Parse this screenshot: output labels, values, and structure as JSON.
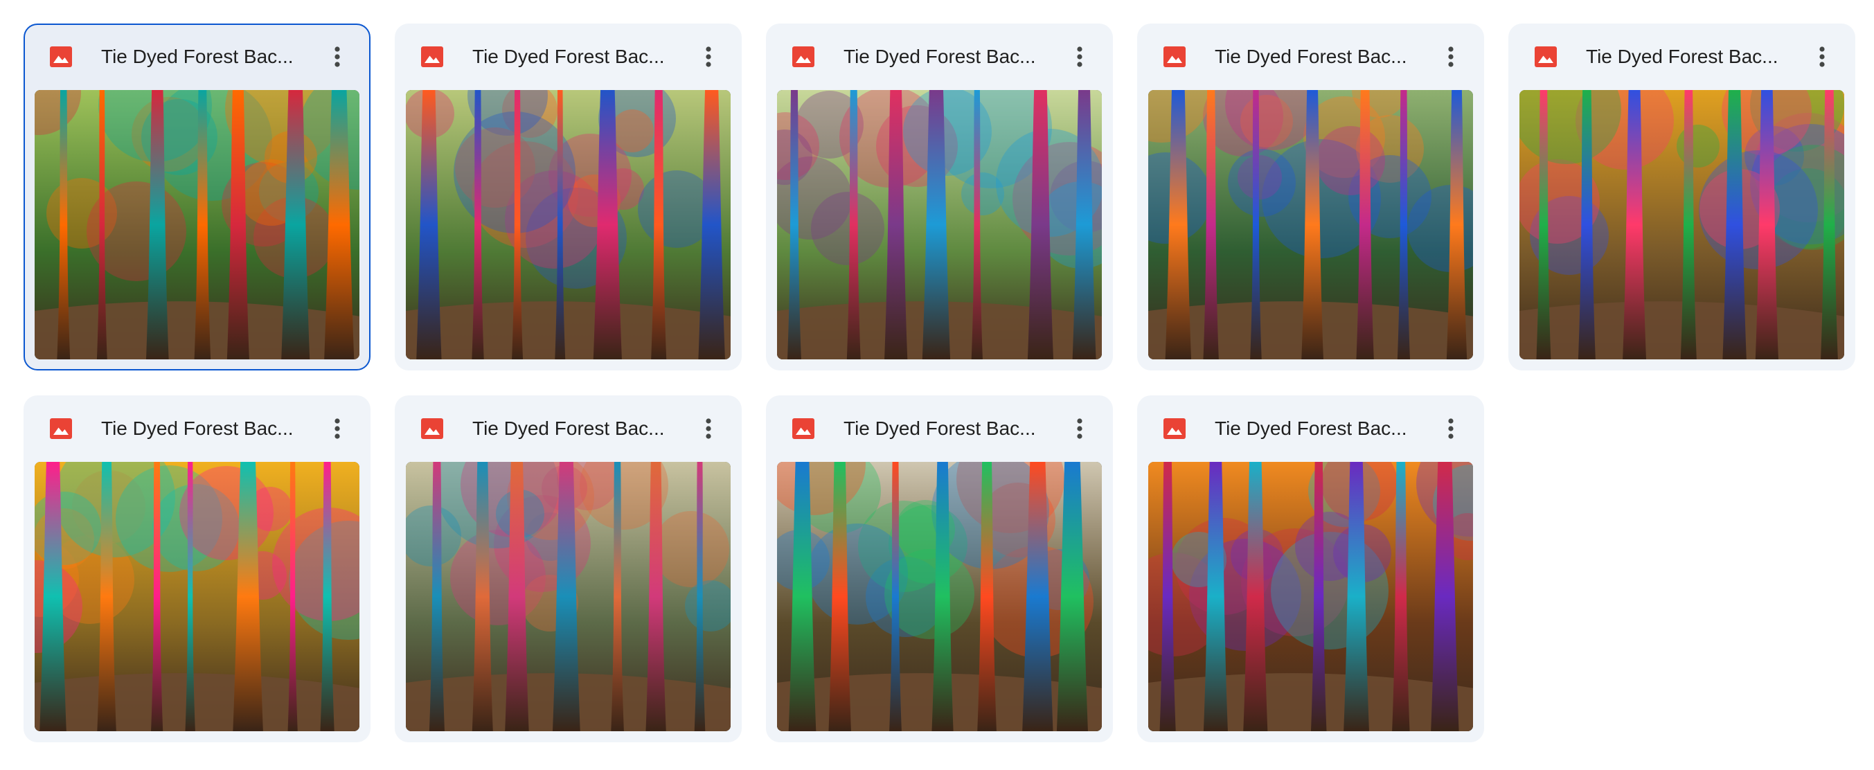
{
  "files": [
    {
      "title": "Tie Dyed Forest Bac...",
      "selected": true,
      "icon": "image-file-icon",
      "palette": [
        "#3a6f2a",
        "#9fc25a",
        "#0aa5a0",
        "#ff6a00",
        "#d6283d"
      ]
    },
    {
      "title": "Tie Dyed Forest Bac...",
      "selected": false,
      "icon": "image-file-icon",
      "palette": [
        "#4f7a35",
        "#b8c77a",
        "#ff5a1f",
        "#2255c8",
        "#e02a6f"
      ]
    },
    {
      "title": "Tie Dyed Forest Bac...",
      "selected": false,
      "icon": "image-file-icon",
      "palette": [
        "#5f8a40",
        "#c8d79a",
        "#7a3a8a",
        "#1d9bd6",
        "#e03060"
      ]
    },
    {
      "title": "Tie Dyed Forest Bac...",
      "selected": false,
      "icon": "image-file-icon",
      "palette": [
        "#2f5e32",
        "#8fb070",
        "#1e5ad8",
        "#ff7a1c",
        "#c42a8a"
      ]
    },
    {
      "title": "Tie Dyed Forest Bac...",
      "selected": false,
      "icon": "image-file-icon",
      "palette": [
        "#7a5a2a",
        "#e0a020",
        "#ff3a6a",
        "#20b04a",
        "#3050e0"
      ]
    },
    {
      "title": "Tie Dyed Forest Bac...",
      "selected": false,
      "icon": "image-file-icon",
      "palette": [
        "#8a6a22",
        "#f0b020",
        "#ff1f8a",
        "#10c0b0",
        "#ff7a10"
      ]
    },
    {
      "title": "Tie Dyed Forest Bac...",
      "selected": false,
      "icon": "image-file-icon",
      "palette": [
        "#5c6a48",
        "#c8c2a0",
        "#d23a7a",
        "#1a8fb8",
        "#e06a3a"
      ]
    },
    {
      "title": "Tie Dyed Forest Bac...",
      "selected": false,
      "icon": "image-file-icon",
      "palette": [
        "#5a4a2a",
        "#cfc6b0",
        "#1a7ad0",
        "#20c060",
        "#ff4a20"
      ]
    },
    {
      "title": "Tie Dyed Forest Bac...",
      "selected": false,
      "icon": "image-file-icon",
      "palette": [
        "#6a3a1a",
        "#f08a20",
        "#d02a4a",
        "#6a2ac0",
        "#1ab0c8"
      ]
    }
  ],
  "colors": {
    "card_bg": "#f0f4f9",
    "selected_border": "#0b57d0",
    "image_icon": "#ea4335",
    "title_text": "#1f1f1f"
  }
}
